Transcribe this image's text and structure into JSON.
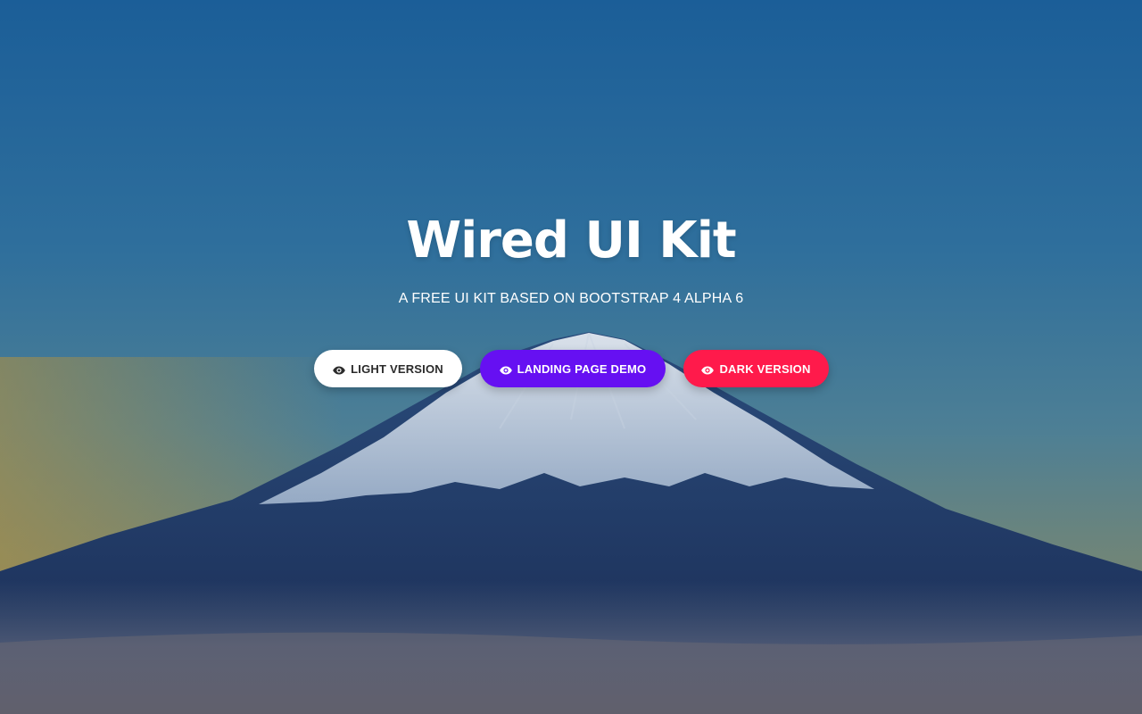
{
  "hero": {
    "title": "Wired UI Kit",
    "subtitle": "A FREE UI KIT BASED ON BOOTSTRAP 4 ALPHA 6",
    "background": "mountain-landscape"
  },
  "buttons": [
    {
      "label": "LIGHT VERSION",
      "icon": "eye-icon",
      "color": "#ffffff",
      "text_color": "#2b2b2b"
    },
    {
      "label": "LANDING PAGE DEMO",
      "icon": "eye-icon",
      "color": "#6610f2",
      "text_color": "#ffffff"
    },
    {
      "label": "DARK VERSION",
      "icon": "eye-icon",
      "color": "#ff1a4b",
      "text_color": "#ffffff"
    }
  ]
}
